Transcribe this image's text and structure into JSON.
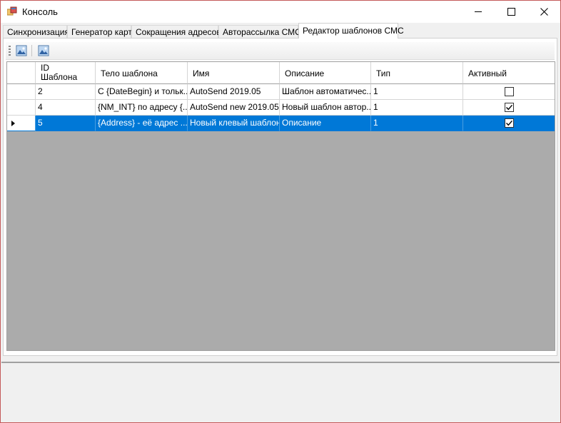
{
  "window": {
    "title": "Консоль",
    "icon": "app-window-icon",
    "controls": [
      "minimize-icon",
      "maximize-icon",
      "close-icon"
    ]
  },
  "tabs": [
    {
      "label": "Синхронизация",
      "active": false
    },
    {
      "label": "Генератор карт",
      "active": false
    },
    {
      "label": "Сокращения адресов",
      "active": false
    },
    {
      "label": "Авторассылка СМС",
      "active": false
    },
    {
      "label": "Редактор шаблонов СМС",
      "active": true
    }
  ],
  "toolbar": {
    "buttons": [
      {
        "icon": "image-icon"
      },
      {
        "icon": "image-icon"
      }
    ]
  },
  "grid": {
    "columns": [
      "ID Шаблона",
      "Тело шаблона",
      "Имя",
      "Описание",
      "Тип",
      "Активный"
    ],
    "header": {
      "id_line1": "ID",
      "id_line2": "Шаблона",
      "body": "Тело шаблона",
      "name": "Имя",
      "description": "Описание",
      "type": "Тип",
      "active": "Активный"
    },
    "rows": [
      {
        "id": "2",
        "body": "С {DateBegin} и тольк...",
        "name": "AutoSend 2019.05",
        "description": "Шаблон автоматичес...",
        "type": "1",
        "active": false,
        "selected": false
      },
      {
        "id": "4",
        "body": "{NM_INT} по адресу {...",
        "name": "AutoSend new 2019.05",
        "description": "Новый шаблон автор...",
        "type": "1",
        "active": true,
        "selected": false
      },
      {
        "id": "5",
        "body": "{Address} - её адрес   ...",
        "name": "Новый клевый шаблон",
        "description": "Описание",
        "type": "1",
        "active": true,
        "selected": true
      }
    ]
  },
  "colors": {
    "selection": "#0078d7",
    "grid_background": "#ababab",
    "window_border": "#c45a5a"
  }
}
